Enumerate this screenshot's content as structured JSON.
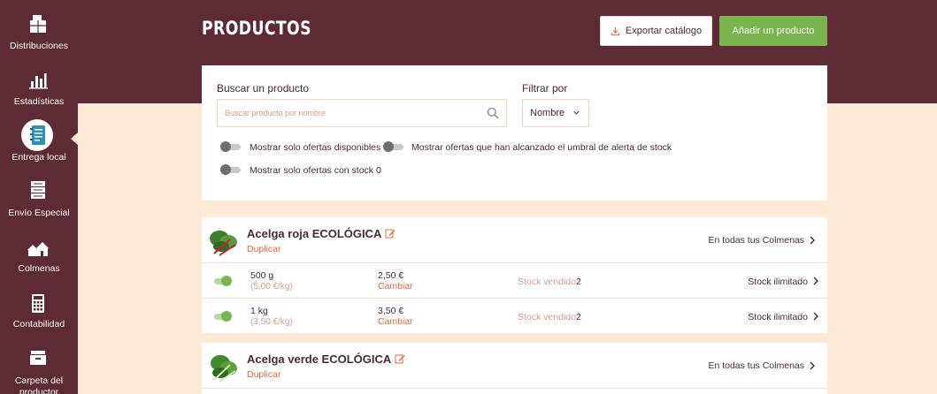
{
  "sidebar": {
    "items": [
      {
        "label": "Distribuciones",
        "icon": "box-stack-icon"
      },
      {
        "label": "Estadísticas",
        "icon": "bar-chart-icon"
      },
      {
        "label": "Entrega local",
        "icon": "notebook-icon",
        "active": true
      },
      {
        "label": "Envío Especial",
        "icon": "parcel-stack-icon"
      },
      {
        "label": "Colmenas",
        "icon": "houses-icon"
      },
      {
        "label": "Contabilidad",
        "icon": "calculator-icon"
      },
      {
        "label": "Carpeta del productor",
        "icon": "folder-icon"
      }
    ]
  },
  "header": {
    "title": "PRODUCTOS",
    "export_label": "Exportar catálogo",
    "add_label": "Añadir un producto"
  },
  "filters": {
    "search_label": "Buscar un producto",
    "search_placeholder": "Buscar producto por nombre",
    "search_value": "",
    "filter_label": "Filtrar por",
    "filter_value": "Nombre",
    "toggles": [
      {
        "label": "Mostrar solo ofertas disponibles",
        "on": false
      },
      {
        "label": "Mostrar ofertas que han alcanzado el umbral de alerta de stock",
        "on": false
      },
      {
        "label": "Mostrar solo ofertas con stock 0",
        "on": false
      }
    ]
  },
  "products": [
    {
      "name": "Acelga roja ECOLÓGICA",
      "duplicate_label": "Duplicar",
      "availability": "En todas tus Colmenas",
      "offers": [
        {
          "quantity": "500 g",
          "unit_price": "(5,00 €/kg)",
          "price": "2,50 €",
          "change_label": "Cambiar",
          "sold_label": "Stock vendido",
          "sold_value": "2",
          "stock_label": "Stock ilimitado",
          "on": true
        },
        {
          "quantity": "1 kg",
          "unit_price": "(3,50 €/kg)",
          "price": "3,50 €",
          "change_label": "Cambiar",
          "sold_label": "Stock vendido",
          "sold_value": "2",
          "stock_label": "Stock ilimitado",
          "on": true
        }
      ]
    },
    {
      "name": "Acelga verde ECOLÓGICA",
      "duplicate_label": "Duplicar",
      "availability": "En todas tus Colmenas",
      "offers": []
    }
  ],
  "colors": {
    "brand_dark": "#5e2a35",
    "accent_green": "#7ab44e",
    "accent_orange": "#e0683c",
    "page_bg": "#fde9d6"
  }
}
